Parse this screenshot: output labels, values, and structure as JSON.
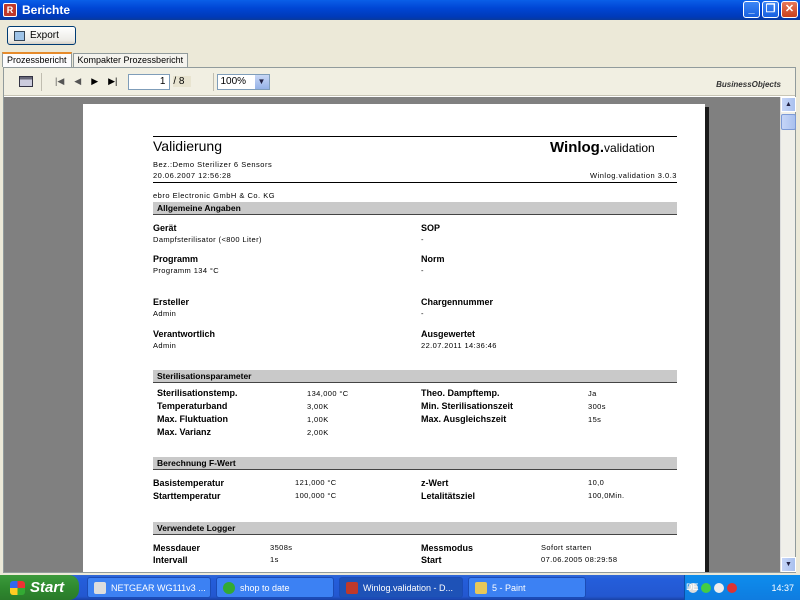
{
  "window": {
    "title": "Berichte",
    "app_icon": "report-icon"
  },
  "toolbar": {
    "export_label": "Export"
  },
  "tabs": [
    {
      "label": "Prozessbericht",
      "active": true
    },
    {
      "label": "Kompakter Prozessbericht",
      "active": false
    }
  ],
  "viewer": {
    "page_current": "1",
    "page_total": "/ 8",
    "zoom": "100%",
    "logo": "BusinessObjects"
  },
  "report": {
    "title": "Validierung",
    "brand_bold": "Winlog.",
    "brand_light": "validation",
    "subtitle": "Bez.:Demo Sterilizer 6 Sensors",
    "datetime": "20.06.2007  12:56:28",
    "version": "Winlog.validation 3.0.3",
    "company": "ebro Electronic GmbH & Co. KG",
    "sections": {
      "general": "Allgemeine Angaben",
      "sterilization": "Sterilisationsparameter",
      "fvalue": "Berechnung F-Wert",
      "logger": "Verwendete Logger"
    },
    "general": {
      "geraet_label": "Gerät",
      "geraet_value": "Dampfsterilisator (<800 Liter)",
      "sop_label": "SOP",
      "sop_value": "-",
      "programm_label": "Programm",
      "programm_value": "Programm 134 °C",
      "norm_label": "Norm",
      "norm_value": "-",
      "ersteller_label": "Ersteller",
      "ersteller_value": "Admin",
      "charge_label": "Chargennummer",
      "charge_value": "-",
      "verantw_label": "Verantwortlich",
      "verantw_value": "Admin",
      "ausgew_label": "Ausgewertet",
      "ausgew_value": "22.07.2011  14:36:46"
    },
    "sterilization": {
      "temp_label": "Sterilisationstemp.",
      "temp_value": "134,000 °C",
      "theo_label": "Theo. Dampftemp.",
      "theo_value": "Ja",
      "band_label": "Temperaturband",
      "band_value": "3,00K",
      "minzeit_label": "Min. Sterilisationszeit",
      "minzeit_value": "300s",
      "fluk_label": "Max. Fluktuation",
      "fluk_value": "1,00K",
      "ausgl_label": "Max. Ausgleichszeit",
      "ausgl_value": "15s",
      "varianz_label": "Max. Varianz",
      "varianz_value": "2,00K"
    },
    "fvalue": {
      "basis_label": "Basistemperatur",
      "basis_value": "121,000 °C",
      "z_label": "z-Wert",
      "z_value": "10,0",
      "start_label": "Starttemperatur",
      "start_value": "100,000 °C",
      "let_label": "Letalitätsziel",
      "let_value": "100,0Min."
    },
    "logger": {
      "dauer_label": "Messdauer",
      "dauer_value": "3508s",
      "modus_label": "Messmodus",
      "modus_value": "Sofort starten",
      "intervall_label": "Intervall",
      "intervall_value": "1s",
      "start_label": "Start",
      "start_value": "07.06.2005  08:29:58"
    }
  },
  "taskbar": {
    "start_label": "Start",
    "tasks": [
      {
        "label": "NETGEAR WG111v3 ..."
      },
      {
        "label": "shop to date"
      },
      {
        "label": "Winlog.validation - D..."
      },
      {
        "label": "5 - Paint"
      }
    ],
    "lang": "DE",
    "clock": "14:37"
  }
}
